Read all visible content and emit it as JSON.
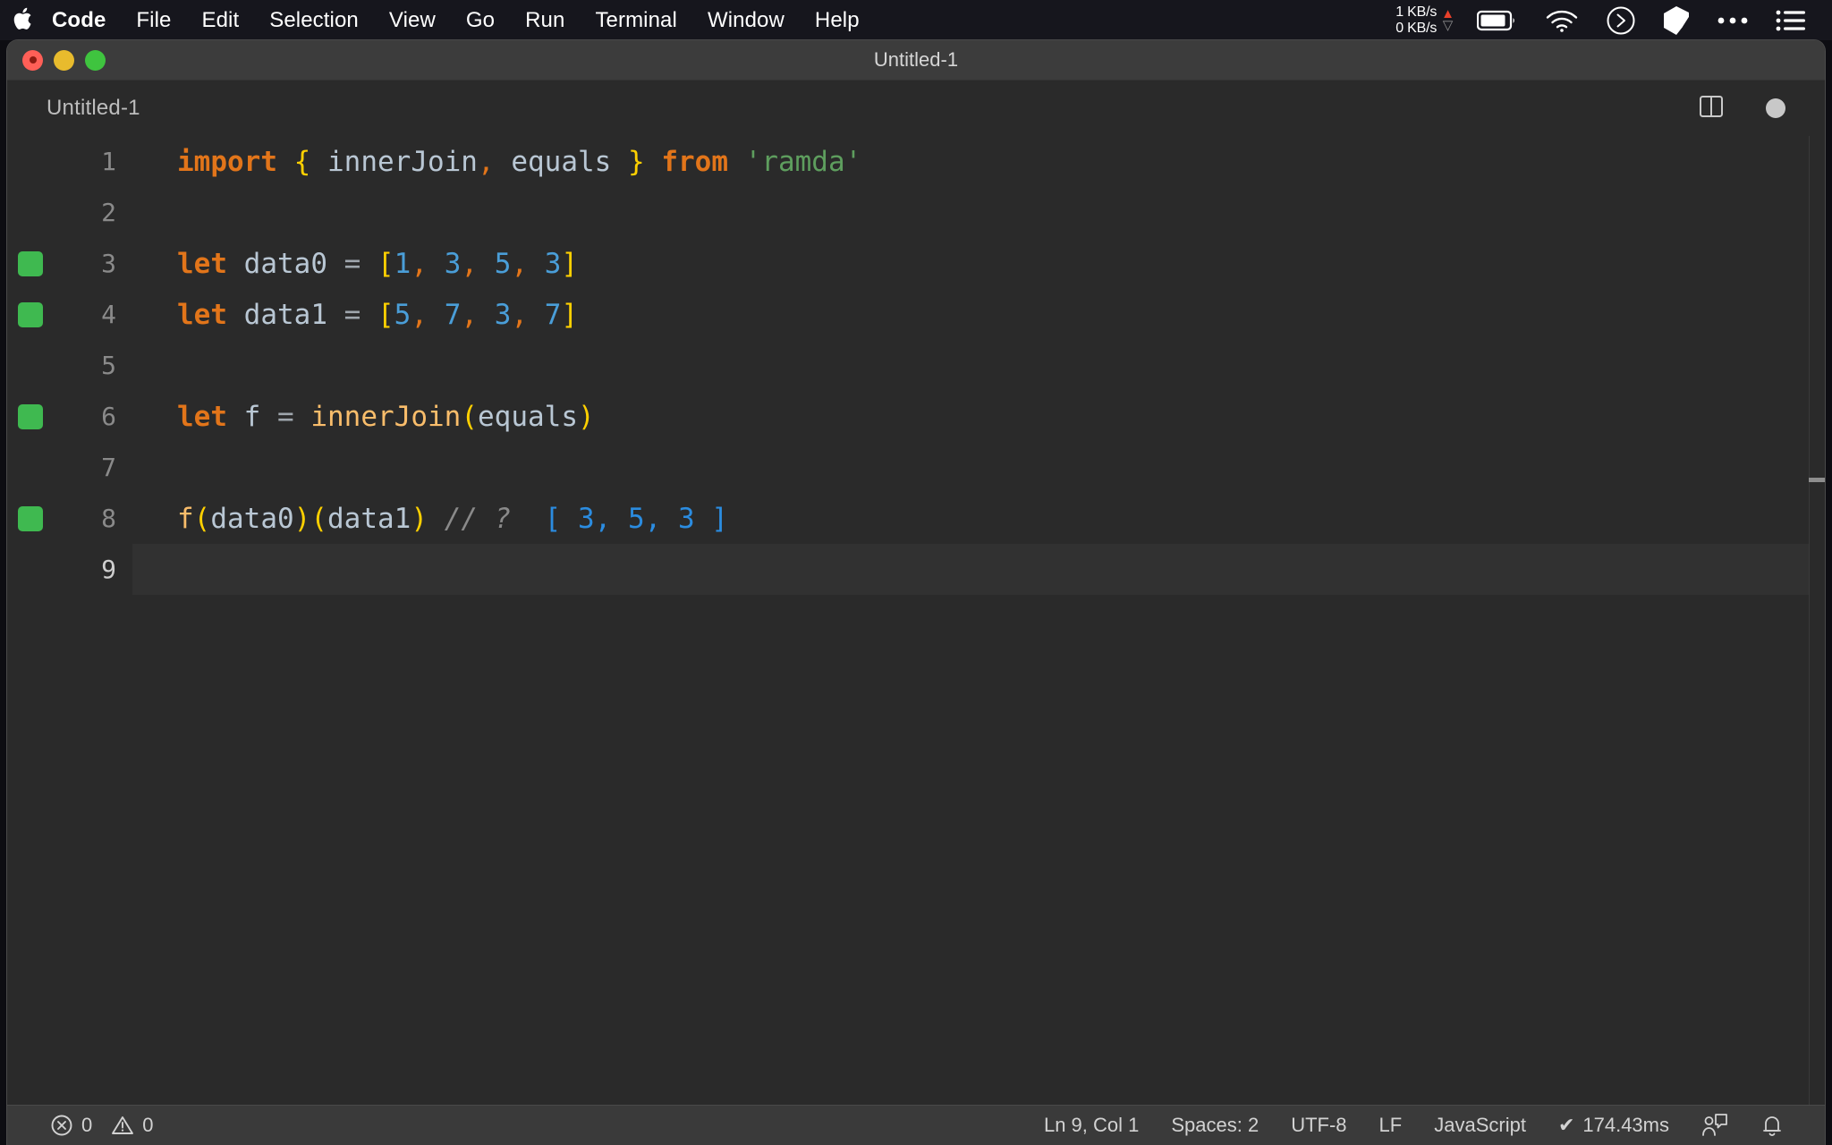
{
  "menubar": {
    "apple_icon": "apple-logo-icon",
    "items": [
      {
        "label": "Code",
        "bold": true
      },
      {
        "label": "File",
        "bold": false
      },
      {
        "label": "Edit",
        "bold": false
      },
      {
        "label": "Selection",
        "bold": false
      },
      {
        "label": "View",
        "bold": false
      },
      {
        "label": "Go",
        "bold": false
      },
      {
        "label": "Run",
        "bold": false
      },
      {
        "label": "Terminal",
        "bold": false
      },
      {
        "label": "Window",
        "bold": false
      },
      {
        "label": "Help",
        "bold": false
      }
    ],
    "network": {
      "upload": "1 KB/s",
      "download": "0 KB/s",
      "up_arrow_color": "#e8402a",
      "down_arrow_color": "#8c8c8c"
    },
    "status_icons": [
      "battery-icon",
      "wifi-icon",
      "clock-circle-icon",
      "cube-icon",
      "ellipsis-icon",
      "control-center-list-icon"
    ]
  },
  "window": {
    "title": "Untitled-1",
    "traffic_lights": [
      "close-button",
      "minimize-button",
      "zoom-button"
    ],
    "close_has_unsaved_dot": true
  },
  "tabstrip": {
    "tab_label": "Untitled-1",
    "actions": [
      "split-editor-icon",
      "unsaved-dot-indicator"
    ]
  },
  "editor": {
    "language": "JavaScript",
    "active_line": 9,
    "lines": [
      {
        "num": "1",
        "quokka": false,
        "active": false,
        "tokens": [
          {
            "text": "import",
            "cls": "t-kw"
          },
          {
            "text": " ",
            "cls": "t-op"
          },
          {
            "text": "{",
            "cls": "t-brace"
          },
          {
            "text": " ",
            "cls": "t-op"
          },
          {
            "text": "innerJoin",
            "cls": "t-var"
          },
          {
            "text": ",",
            "cls": "t-punc"
          },
          {
            "text": " ",
            "cls": "t-op"
          },
          {
            "text": "equals",
            "cls": "t-var"
          },
          {
            "text": " ",
            "cls": "t-op"
          },
          {
            "text": "}",
            "cls": "t-brace"
          },
          {
            "text": " ",
            "cls": "t-op"
          },
          {
            "text": "from",
            "cls": "t-kw"
          },
          {
            "text": " ",
            "cls": "t-op"
          },
          {
            "text": "'ramda'",
            "cls": "t-str"
          }
        ]
      },
      {
        "num": "2",
        "quokka": false,
        "active": false,
        "tokens": []
      },
      {
        "num": "3",
        "quokka": true,
        "active": false,
        "tokens": [
          {
            "text": "let",
            "cls": "t-kw"
          },
          {
            "text": " ",
            "cls": "t-op"
          },
          {
            "text": "data0",
            "cls": "t-var"
          },
          {
            "text": " = ",
            "cls": "t-op"
          },
          {
            "text": "[",
            "cls": "t-brace"
          },
          {
            "text": "1",
            "cls": "t-num"
          },
          {
            "text": ",",
            "cls": "t-punc"
          },
          {
            "text": " ",
            "cls": "t-op"
          },
          {
            "text": "3",
            "cls": "t-num"
          },
          {
            "text": ",",
            "cls": "t-punc"
          },
          {
            "text": " ",
            "cls": "t-op"
          },
          {
            "text": "5",
            "cls": "t-num"
          },
          {
            "text": ",",
            "cls": "t-punc"
          },
          {
            "text": " ",
            "cls": "t-op"
          },
          {
            "text": "3",
            "cls": "t-num"
          },
          {
            "text": "]",
            "cls": "t-brace"
          }
        ]
      },
      {
        "num": "4",
        "quokka": true,
        "active": false,
        "tokens": [
          {
            "text": "let",
            "cls": "t-kw"
          },
          {
            "text": " ",
            "cls": "t-op"
          },
          {
            "text": "data1",
            "cls": "t-var"
          },
          {
            "text": " = ",
            "cls": "t-op"
          },
          {
            "text": "[",
            "cls": "t-brace"
          },
          {
            "text": "5",
            "cls": "t-num"
          },
          {
            "text": ",",
            "cls": "t-punc"
          },
          {
            "text": " ",
            "cls": "t-op"
          },
          {
            "text": "7",
            "cls": "t-num"
          },
          {
            "text": ",",
            "cls": "t-punc"
          },
          {
            "text": " ",
            "cls": "t-op"
          },
          {
            "text": "3",
            "cls": "t-num"
          },
          {
            "text": ",",
            "cls": "t-punc"
          },
          {
            "text": " ",
            "cls": "t-op"
          },
          {
            "text": "7",
            "cls": "t-num"
          },
          {
            "text": "]",
            "cls": "t-brace"
          }
        ]
      },
      {
        "num": "5",
        "quokka": false,
        "active": false,
        "tokens": []
      },
      {
        "num": "6",
        "quokka": true,
        "active": false,
        "tokens": [
          {
            "text": "let",
            "cls": "t-kw"
          },
          {
            "text": " ",
            "cls": "t-op"
          },
          {
            "text": "f",
            "cls": "t-var"
          },
          {
            "text": " = ",
            "cls": "t-op"
          },
          {
            "text": "innerJoin",
            "cls": "t-fn"
          },
          {
            "text": "(",
            "cls": "t-brace"
          },
          {
            "text": "equals",
            "cls": "t-var"
          },
          {
            "text": ")",
            "cls": "t-brace"
          }
        ]
      },
      {
        "num": "7",
        "quokka": false,
        "active": false,
        "tokens": []
      },
      {
        "num": "8",
        "quokka": true,
        "active": false,
        "tokens": [
          {
            "text": "f",
            "cls": "t-fn"
          },
          {
            "text": "(",
            "cls": "t-brace"
          },
          {
            "text": "data0",
            "cls": "t-var"
          },
          {
            "text": ")",
            "cls": "t-brace"
          },
          {
            "text": "(",
            "cls": "t-brace"
          },
          {
            "text": "data1",
            "cls": "t-var"
          },
          {
            "text": ")",
            "cls": "t-brace"
          },
          {
            "text": " ",
            "cls": "t-op"
          },
          {
            "text": "// ?",
            "cls": "t-comment"
          },
          {
            "text": "  ",
            "cls": "t-op"
          },
          {
            "text": "[ 3, 5, 3 ]",
            "cls": "t-result"
          }
        ]
      },
      {
        "num": "9",
        "quokka": false,
        "active": true,
        "tokens": []
      }
    ]
  },
  "statusbar": {
    "errors": "0",
    "warnings": "0",
    "cursor": "Ln 9, Col 1",
    "indentation": "Spaces: 2",
    "encoding": "UTF-8",
    "eol": "LF",
    "language": "JavaScript",
    "runtime": "174.43ms",
    "runtime_check": "✔",
    "right_icons": [
      "feedback-icon",
      "notifications-bell-icon"
    ]
  }
}
